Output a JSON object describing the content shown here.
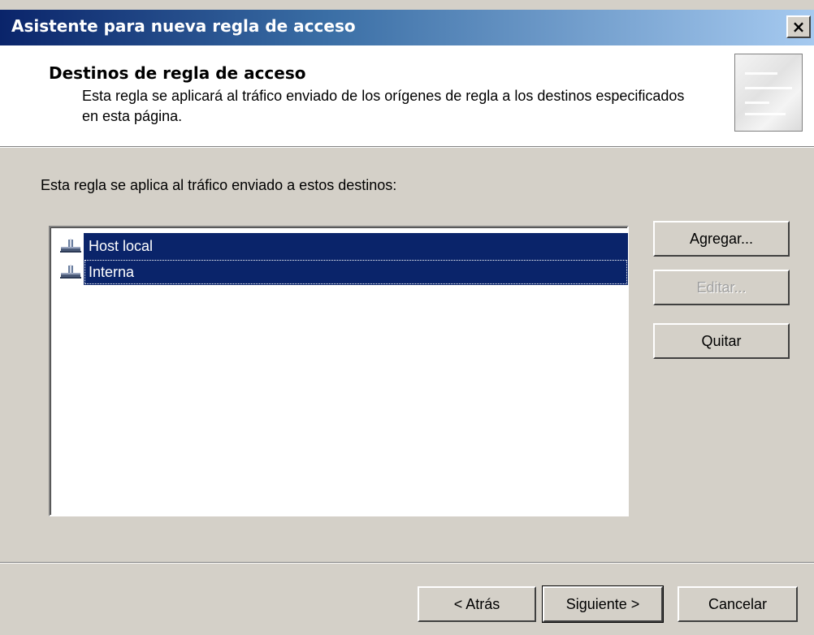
{
  "window": {
    "title": "Asistente para nueva regla de acceso",
    "close_glyph": "×",
    "title_bar_color_start": "#0a246a",
    "title_bar_color_end": "#a6caf0"
  },
  "header": {
    "title": "Destinos de regla de acceso",
    "description": "Esta regla se aplicará al tráfico enviado de los orígenes de regla a los destinos especificados en esta página."
  },
  "body": {
    "prompt": "Esta regla se aplica al tráfico enviado a estos destinos:",
    "destinations": [
      {
        "label": "Host local",
        "icon": "network-icon",
        "selected": true
      },
      {
        "label": "Interna",
        "icon": "network-icon",
        "selected": true
      }
    ],
    "selection_color": "#0a246a"
  },
  "side_buttons": {
    "add": "Agregar...",
    "edit": "Editar...",
    "remove": "Quitar"
  },
  "footer": {
    "back": "< Atrás",
    "next": "Siguiente >",
    "cancel": "Cancelar"
  }
}
